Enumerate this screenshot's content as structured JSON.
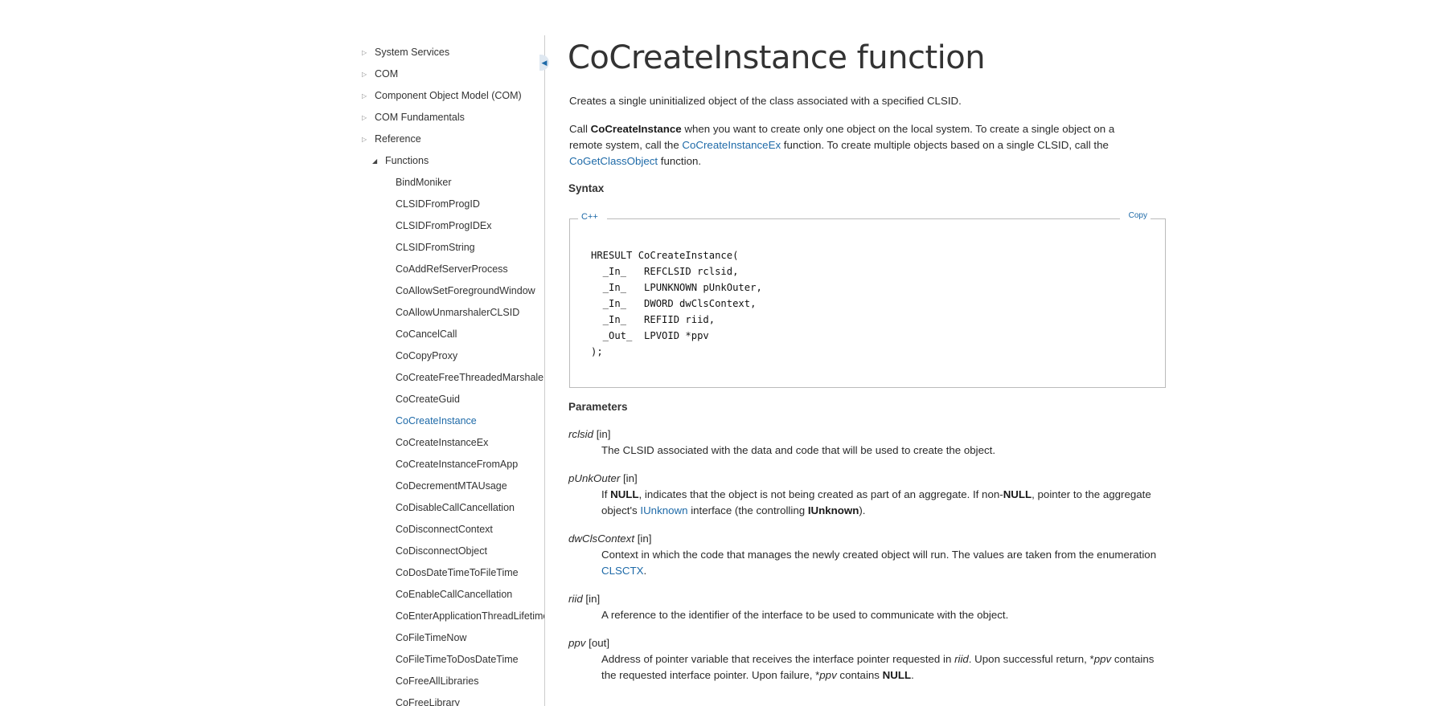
{
  "nav": {
    "items": [
      {
        "label": "System Services",
        "level": 0,
        "expanded": false
      },
      {
        "label": "COM",
        "level": 0,
        "expanded": false
      },
      {
        "label": "Component Object Model (COM)",
        "level": 0,
        "expanded": false
      },
      {
        "label": "COM Fundamentals",
        "level": 0,
        "expanded": false
      },
      {
        "label": "Reference",
        "level": 0,
        "expanded": false
      },
      {
        "label": "Functions",
        "level": 1,
        "expanded": true
      },
      {
        "label": "BindMoniker",
        "level": 2
      },
      {
        "label": "CLSIDFromProgID",
        "level": 2
      },
      {
        "label": "CLSIDFromProgIDEx",
        "level": 2
      },
      {
        "label": "CLSIDFromString",
        "level": 2
      },
      {
        "label": "CoAddRefServerProcess",
        "level": 2
      },
      {
        "label": "CoAllowSetForegroundWindow",
        "level": 2
      },
      {
        "label": "CoAllowUnmarshalerCLSID",
        "level": 2
      },
      {
        "label": "CoCancelCall",
        "level": 2
      },
      {
        "label": "CoCopyProxy",
        "level": 2
      },
      {
        "label": "CoCreateFreeThreadedMarshaler",
        "level": 2
      },
      {
        "label": "CoCreateGuid",
        "level": 2
      },
      {
        "label": "CoCreateInstance",
        "level": 2,
        "current": true
      },
      {
        "label": "CoCreateInstanceEx",
        "level": 2
      },
      {
        "label": "CoCreateInstanceFromApp",
        "level": 2
      },
      {
        "label": "CoDecrementMTAUsage",
        "level": 2
      },
      {
        "label": "CoDisableCallCancellation",
        "level": 2
      },
      {
        "label": "CoDisconnectContext",
        "level": 2
      },
      {
        "label": "CoDisconnectObject",
        "level": 2
      },
      {
        "label": "CoDosDateTimeToFileTime",
        "level": 2
      },
      {
        "label": "CoEnableCallCancellation",
        "level": 2
      },
      {
        "label": "CoEnterApplicationThreadLifetimeLoop",
        "level": 2
      },
      {
        "label": "CoFileTimeNow",
        "level": 2
      },
      {
        "label": "CoFileTimeToDosDateTime",
        "level": 2
      },
      {
        "label": "CoFreeAllLibraries",
        "level": 2
      },
      {
        "label": "CoFreeLibrary",
        "level": 2
      }
    ]
  },
  "colors": {
    "link": "#1e6aa8",
    "text": "#2a2a2a",
    "divider": "#cccccc"
  },
  "icons": {
    "collapsed": "triangle-right-icon",
    "expanded": "triangle-down-icon",
    "collapse_handle": "chevron-left-icon"
  },
  "article": {
    "title": "CoCreateInstance function",
    "summary": "Creates a single uninitialized object of the class associated with a specified CLSID.",
    "intro": {
      "t1": "Call ",
      "b1": "CoCreateInstance",
      "t2": " when you want to create only one object on the local system. To create a single object on a remote system, call the ",
      "link1": "CoCreateInstanceEx",
      "t3": " function. To create multiple objects based on a single CLSID, call the ",
      "link2": "CoGetClassObject",
      "t4": " function."
    },
    "syntax_heading": "Syntax",
    "code": {
      "language": "C++",
      "copy_label": "Copy",
      "text": "HRESULT CoCreateInstance(\n  _In_   REFCLSID rclsid,\n  _In_   LPUNKNOWN pUnkOuter,\n  _In_   DWORD dwClsContext,\n  _In_   REFIID riid,\n  _Out_  LPVOID *ppv\n);"
    },
    "parameters_heading": "Parameters",
    "params": [
      {
        "name": "rclsid",
        "dir": " [in]",
        "desc": {
          "t1": "The CLSID associated with the data and code that will be used to create the object."
        }
      },
      {
        "name": "pUnkOuter",
        "dir": " [in]",
        "desc": {
          "t1": "If ",
          "b1": "NULL",
          "t2": ", indicates that the object is not being created as part of an aggregate. If non-",
          "b2": "NULL",
          "t3": ", pointer to the aggregate object's ",
          "link1": "IUnknown",
          "t4": " interface (the controlling ",
          "b3": "IUnknown",
          "t5": ")."
        }
      },
      {
        "name": "dwClsContext",
        "dir": " [in]",
        "desc": {
          "t1": "Context in which the code that manages the newly created object will run. The values are taken from the enumeration ",
          "link1": "CLSCTX",
          "t2": "."
        }
      },
      {
        "name": "riid",
        "dir": " [in]",
        "desc": {
          "t1": "A reference to the identifier of the interface to be used to communicate with the object."
        }
      },
      {
        "name": "ppv",
        "dir": " [out]",
        "desc": {
          "t1": "Address of pointer variable that receives the interface pointer requested in ",
          "i1": "riid",
          "t2": ". Upon successful return, *",
          "i2": "ppv",
          "t3": " contains the requested interface pointer. Upon failure, *",
          "i3": "ppv",
          "t4": " contains ",
          "b1": "NULL",
          "t5": "."
        }
      }
    ]
  }
}
